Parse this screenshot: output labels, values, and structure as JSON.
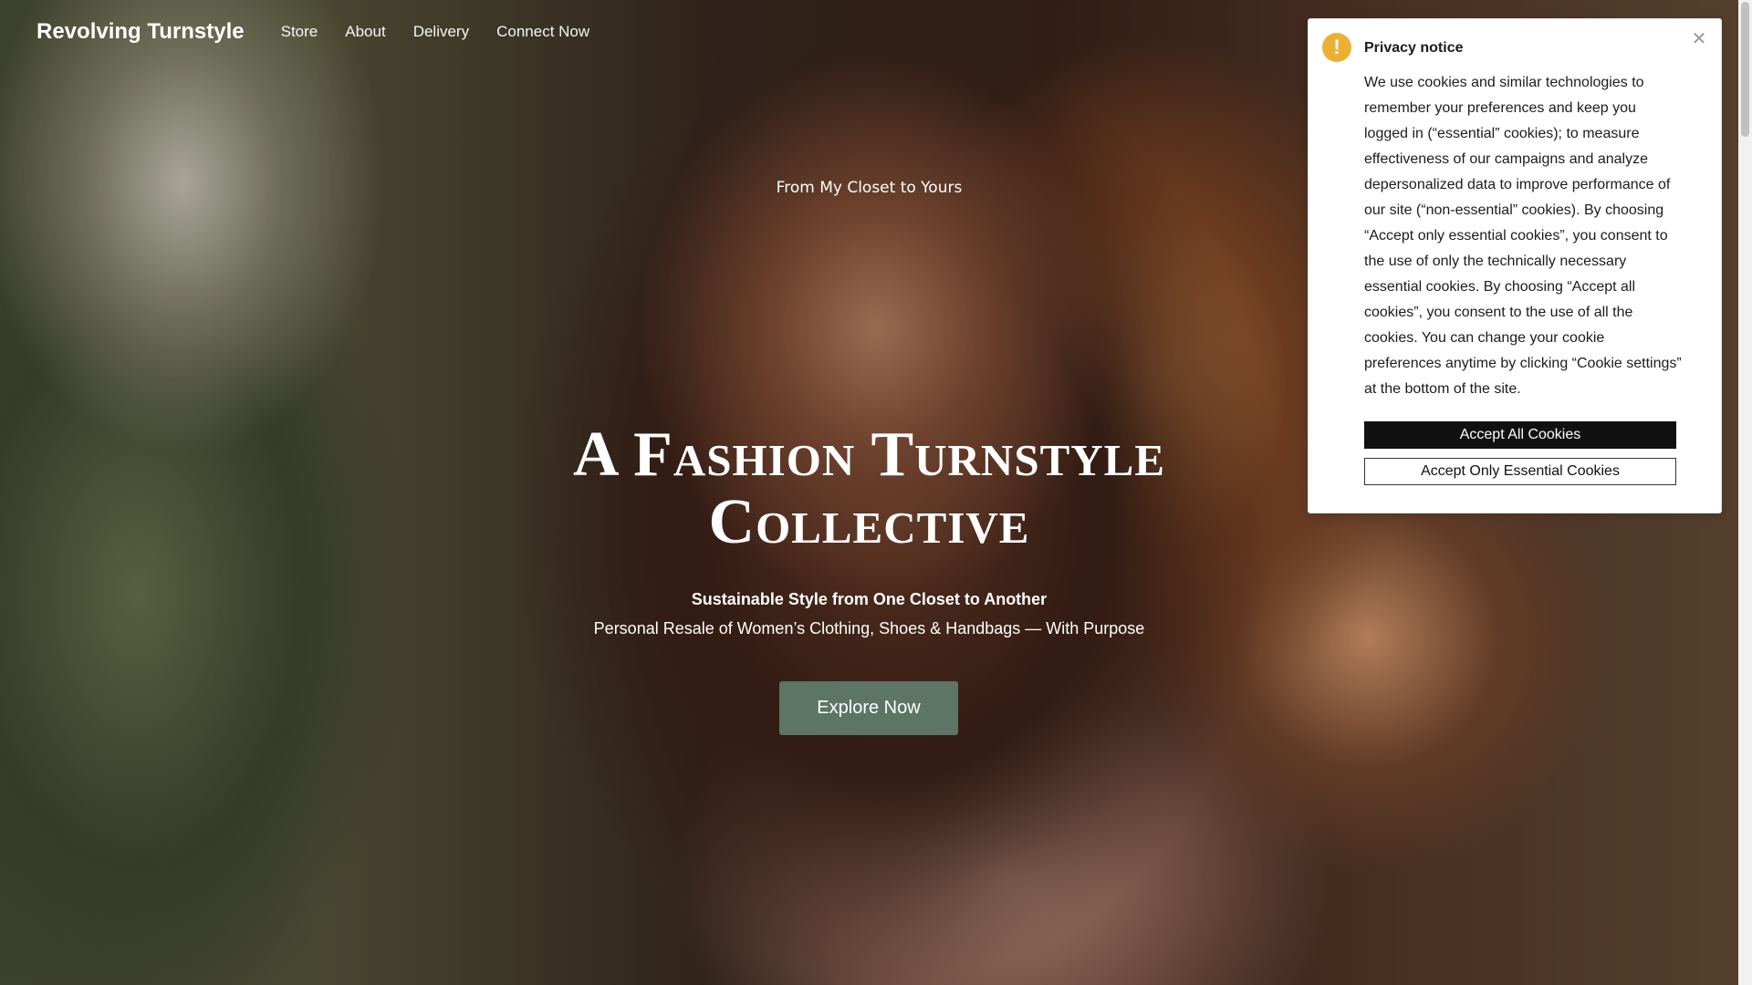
{
  "nav": {
    "brand": "Revolving Turnstyle",
    "links": [
      "Store",
      "About",
      "Delivery",
      "Connect Now"
    ]
  },
  "hero": {
    "kicker": "From My Closet to Yours",
    "title_line1": "A Fashion Turnstyle",
    "title_line2": "Collective",
    "subtitle_strong": "Sustainable Style from One Closet to Another",
    "subtitle": "Personal Resale of Women’s Clothing, Shoes & Handbags — With Purpose",
    "cta_label": "Explore Now"
  },
  "privacy_notice": {
    "title": "Privacy notice",
    "body": "We use cookies and similar technologies to remember your preferences and keep you logged in (“essential” cookies); to measure effectiveness of our campaigns and analyze depersonalized data to improve performance of our site (“non-essential” cookies). By choosing “Accept only essential cookies”, you consent to the use of only the technically necessary essential cookies. By choosing “Accept all cookies”, you consent to the use of all the cookies. You can change your cookie preferences anytime by clicking “Cookie settings” at the bottom of the site.",
    "accept_all_label": "Accept All Cookies",
    "accept_essential_label": "Accept Only Essential Cookies",
    "alert_icon_glyph": "!",
    "close_icon_glyph": "✕"
  },
  "colors": {
    "cta_background": "#5c7565",
    "alert_icon": "#eeb032",
    "accept_all_background": "#111111"
  }
}
